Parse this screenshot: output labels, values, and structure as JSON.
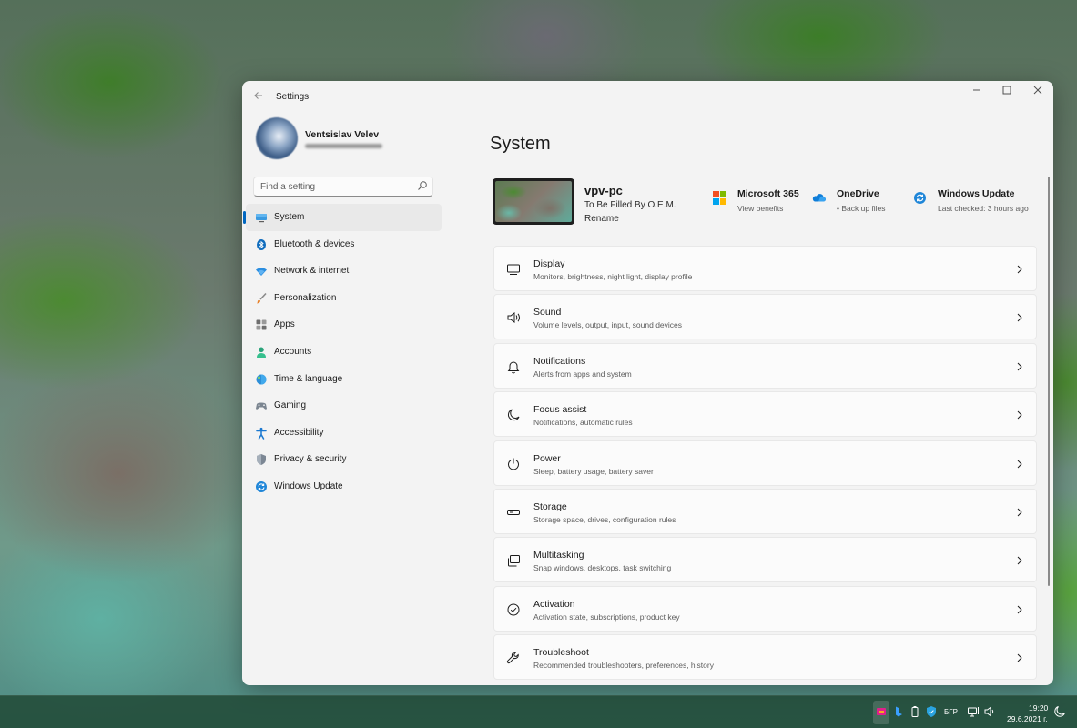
{
  "window": {
    "app_title": "Settings",
    "back_icon": "arrow-left-icon",
    "controls": {
      "minimize": "—",
      "maximize": "☐",
      "close": "✕"
    }
  },
  "profile": {
    "name": "Ventsislav Velev"
  },
  "search": {
    "placeholder": "Find a setting",
    "value": ""
  },
  "sidebar": {
    "items": [
      {
        "label": "System",
        "icon": "monitor-icon",
        "active": true
      },
      {
        "label": "Bluetooth & devices",
        "icon": "bluetooth-icon",
        "active": false
      },
      {
        "label": "Network & internet",
        "icon": "wifi-icon",
        "active": false
      },
      {
        "label": "Personalization",
        "icon": "brush-icon",
        "active": false
      },
      {
        "label": "Apps",
        "icon": "apps-icon",
        "active": false
      },
      {
        "label": "Accounts",
        "icon": "person-icon",
        "active": false
      },
      {
        "label": "Time & language",
        "icon": "globe-clock-icon",
        "active": false
      },
      {
        "label": "Gaming",
        "icon": "gamepad-icon",
        "active": false
      },
      {
        "label": "Accessibility",
        "icon": "accessibility-icon",
        "active": false
      },
      {
        "label": "Privacy & security",
        "icon": "shield-icon",
        "active": false
      },
      {
        "label": "Windows Update",
        "icon": "update-icon",
        "active": false
      }
    ]
  },
  "main": {
    "title": "System",
    "device": {
      "name": "vpv-pc",
      "model": "To Be Filled By O.E.M.",
      "rename": "Rename"
    },
    "quick_links": {
      "m365": {
        "title": "Microsoft 365",
        "subtitle": "View benefits"
      },
      "onedrive": {
        "title": "OneDrive",
        "subtitle": "• Back up files"
      },
      "windows_update": {
        "title": "Windows Update",
        "subtitle": "Last checked: 3 hours ago"
      }
    },
    "cards": [
      {
        "title": "Display",
        "subtitle": "Monitors, brightness, night light, display profile",
        "icon": "display-icon"
      },
      {
        "title": "Sound",
        "subtitle": "Volume levels, output, input, sound devices",
        "icon": "speaker-icon"
      },
      {
        "title": "Notifications",
        "subtitle": "Alerts from apps and system",
        "icon": "bell-icon"
      },
      {
        "title": "Focus assist",
        "subtitle": "Notifications, automatic rules",
        "icon": "moon-icon"
      },
      {
        "title": "Power",
        "subtitle": "Sleep, battery usage, battery saver",
        "icon": "power-icon"
      },
      {
        "title": "Storage",
        "subtitle": "Storage space, drives, configuration rules",
        "icon": "storage-icon"
      },
      {
        "title": "Multitasking",
        "subtitle": "Snap windows, desktops, task switching",
        "icon": "multitasking-icon"
      },
      {
        "title": "Activation",
        "subtitle": "Activation state, subscriptions, product key",
        "icon": "check-circle-icon"
      },
      {
        "title": "Troubleshoot",
        "subtitle": "Recommended troubleshooters, preferences, history",
        "icon": "wrench-icon"
      }
    ]
  },
  "taskbar": {
    "language": "БГР",
    "time": "19:20",
    "date": "29.6.2021 г."
  },
  "colors": {
    "accent": "#0067c0",
    "window_bg": "#f3f3f3",
    "card_bg": "#fbfbfb"
  }
}
